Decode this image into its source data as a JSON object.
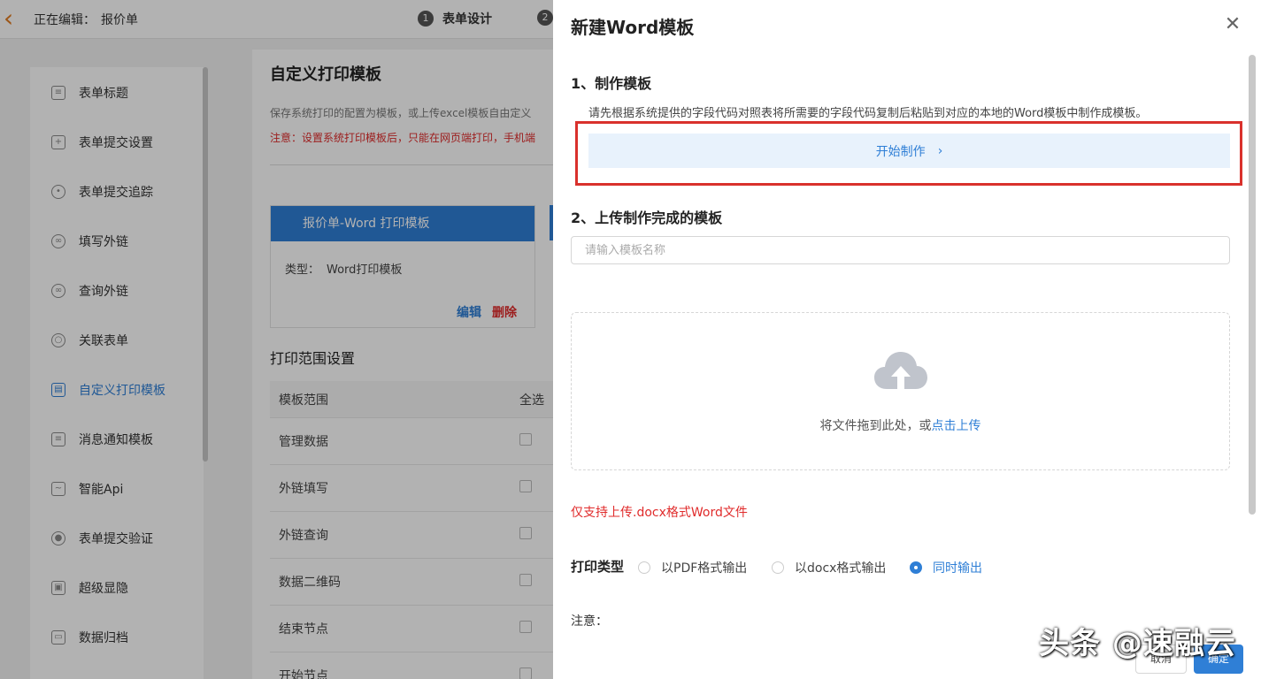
{
  "header": {
    "editing_label": "正在编辑：",
    "form_name": "报价单",
    "steps": [
      {
        "num": "1",
        "label": "表单设计"
      },
      {
        "num": "2",
        "label": ""
      }
    ]
  },
  "sidebar": {
    "items": [
      {
        "label": "表单标题",
        "icon": "document-icon"
      },
      {
        "label": "表单提交设置",
        "icon": "file-settings-icon"
      },
      {
        "label": "表单提交追踪",
        "icon": "eye-icon"
      },
      {
        "label": "填写外链",
        "icon": "link-icon"
      },
      {
        "label": "查询外链",
        "icon": "link-icon"
      },
      {
        "label": "关联表单",
        "icon": "chain-icon"
      },
      {
        "label": "自定义打印模板",
        "icon": "printer-icon",
        "active": true
      },
      {
        "label": "消息通知模板",
        "icon": "message-icon"
      },
      {
        "label": "智能Api",
        "icon": "api-icon"
      },
      {
        "label": "表单提交验证",
        "icon": "user-check-icon"
      },
      {
        "label": "超级显隐",
        "icon": "visibility-icon"
      },
      {
        "label": "数据归档",
        "icon": "folder-icon"
      }
    ]
  },
  "content": {
    "title": "自定义打印模板",
    "desc": "保存系统打印的配置为模板，或上传excel模板自由定义",
    "warning": "注意：设置系统打印模板后，只能在网页端打印，手机端",
    "template_card": {
      "header": "报价单-Word 打印模板",
      "type_label": "类型：",
      "type_value": "Word打印模板",
      "edit": "编辑",
      "delete": "删除"
    },
    "range_title": "打印范围设置",
    "range_table": {
      "col1": "模板范围",
      "col2": "全选",
      "rows": [
        "管理数据",
        "外链填写",
        "外链查询",
        "数据二维码",
        "结束节点",
        "开始节点"
      ]
    }
  },
  "drawer": {
    "title": "新建Word模板",
    "section1_title": "1、制作模板",
    "instruction": "请先根据系统提供的字段代码对照表将所需要的字段代码复制后粘贴到对应的本地的Word模板中制作成模板。",
    "start_button": "开始制作",
    "section2_title": "2、上传制作完成的模板",
    "name_placeholder": "请输入模板名称",
    "drop_text": "将文件拖到此处，或",
    "drop_link": "点击上传",
    "only_docx": "仅支持上传.docx格式Word文件",
    "print_type_label": "打印类型",
    "print_types": [
      {
        "label": "以PDF格式输出",
        "selected": false
      },
      {
        "label": "以docx格式输出",
        "selected": false
      },
      {
        "label": "同时输出",
        "selected": true
      }
    ],
    "note_label": "注意：",
    "cancel": "取消",
    "confirm": "确定"
  },
  "watermark": "头条 @速融云",
  "colors": {
    "primary": "#2f7fd6",
    "danger": "#e02b2b",
    "highlight_box": "#d9312c",
    "back_arrow": "#e07a1f"
  }
}
